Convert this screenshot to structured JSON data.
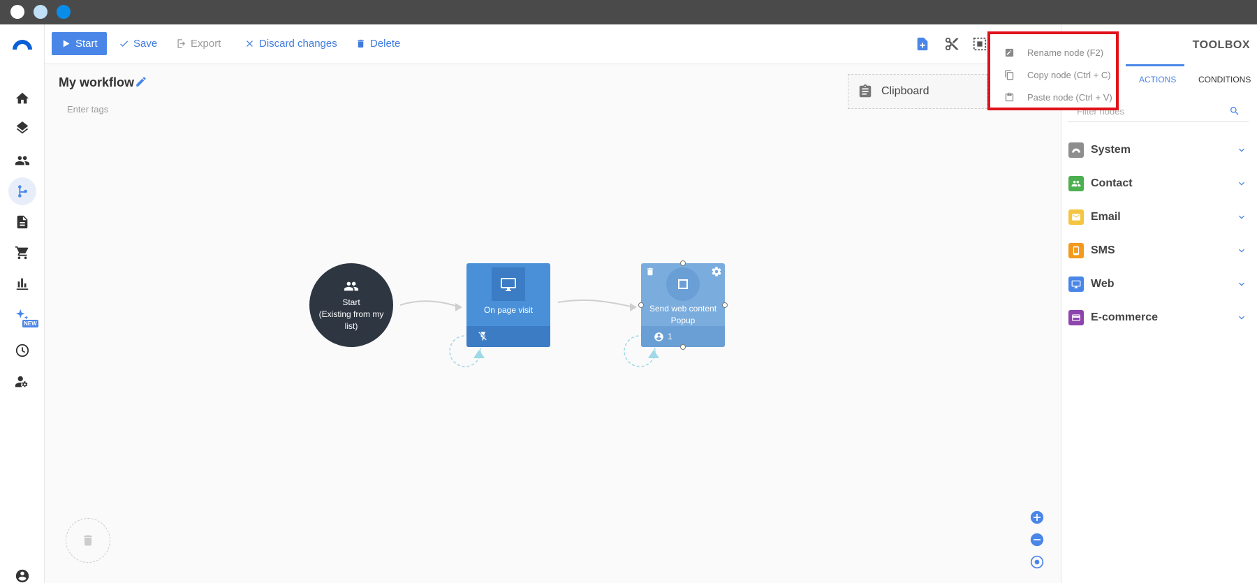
{
  "window": {
    "title_bar_buttons": [
      "close",
      "minimize",
      "maximize"
    ]
  },
  "sidebar": {
    "items": [
      "home-icon",
      "layers-icon",
      "contacts-icon",
      "workflow-icon",
      "document-icon",
      "cart-icon",
      "reports-icon",
      "ai-sparkle-icon",
      "dashboard-icon",
      "user-settings-icon",
      "account-icon"
    ],
    "new_badge": "NEW",
    "active": "workflow-icon"
  },
  "toolbar": {
    "start_label": "Start",
    "save_label": "Save",
    "export_label": "Export",
    "discard_label": "Discard changes",
    "delete_label": "Delete"
  },
  "workflow": {
    "title": "My workflow",
    "tags_placeholder": "Enter tags"
  },
  "clipboard": {
    "label": "Clipboard"
  },
  "context_menu": {
    "items": [
      {
        "label": "Rename node (F2)",
        "icon": "rename-icon"
      },
      {
        "label": "Copy node (Ctrl + C)",
        "icon": "copy-icon"
      },
      {
        "label": "Paste node (Ctrl + V)",
        "icon": "paste-icon"
      }
    ]
  },
  "toolbox": {
    "title": "TOOLBOX",
    "tabs": [
      {
        "label": "ACTIONS",
        "active": true
      },
      {
        "label": "CONDITIONS",
        "active": false
      }
    ],
    "filter_placeholder": "Filter nodes",
    "categories": [
      {
        "label": "System",
        "color": "#8e8e8e"
      },
      {
        "label": "Contact",
        "color": "#4caf50"
      },
      {
        "label": "Email",
        "color": "#f5c542"
      },
      {
        "label": "SMS",
        "color": "#f39a1e"
      },
      {
        "label": "Web",
        "color": "#4a86e8"
      },
      {
        "label": "E-commerce",
        "color": "#8e44ad"
      }
    ]
  },
  "canvas": {
    "nodes": [
      {
        "type": "start",
        "label": "Start\n(Existing from my list)"
      },
      {
        "type": "trigger",
        "label": "On page visit"
      },
      {
        "type": "action",
        "label": "Send web content Popup",
        "contact_count": "1"
      }
    ]
  },
  "colors": {
    "accent": "#4a86e8",
    "node_dark": "#2e3642",
    "highlight": "#e0111b"
  }
}
